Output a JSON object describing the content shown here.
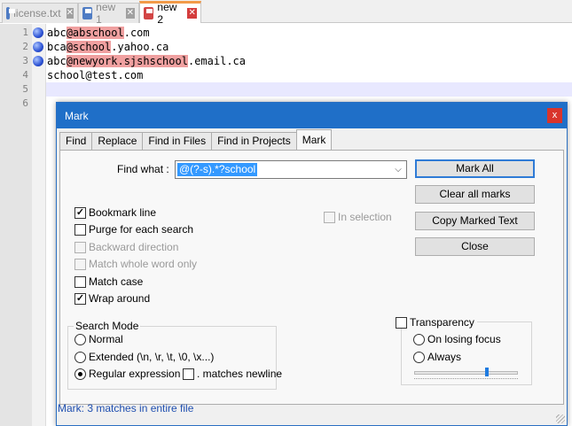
{
  "tabs": [
    {
      "label": "license.txt",
      "icon": "save-file-icon",
      "active": false
    },
    {
      "label": "new 1",
      "icon": "save-file-icon",
      "active": false
    },
    {
      "label": "new 2",
      "icon": "unsaved-file-icon",
      "active": true
    }
  ],
  "editor": {
    "lines": [
      {
        "num": "1",
        "bookmark": true,
        "pre": "abc",
        "hl": "@abschool",
        "post": ".com"
      },
      {
        "num": "2",
        "bookmark": true,
        "pre": "bca",
        "hl": "@school",
        "post": ".yahoo.ca"
      },
      {
        "num": "3",
        "bookmark": true,
        "pre": "abc",
        "hl": "@newyork.sjshschool",
        "post": ".email.ca"
      },
      {
        "num": "4",
        "bookmark": false,
        "pre": "school@test.com",
        "hl": "",
        "post": ""
      },
      {
        "num": "5",
        "bookmark": false,
        "pre": "",
        "hl": "",
        "post": ""
      },
      {
        "num": "6",
        "bookmark": false,
        "pre": "",
        "hl": "",
        "post": ""
      }
    ],
    "highlight_color": "#f0a0a0"
  },
  "dialog": {
    "title": "Mark",
    "close_glyph": "x",
    "tabs": [
      "Find",
      "Replace",
      "Find in Files",
      "Find in Projects",
      "Mark"
    ],
    "find_what_label": "Find what :",
    "find_what_value": "@(?-s).*?school",
    "in_selection": "In selection",
    "buttons": {
      "mark_all": "Mark All",
      "clear_all": "Clear all marks",
      "copy_marked": "Copy Marked Text",
      "close": "Close"
    },
    "options": {
      "bookmark_line": "Bookmark line",
      "purge": "Purge for each search",
      "backward": "Backward direction",
      "whole_word": "Match whole word only",
      "match_case": "Match case",
      "wrap_around": "Wrap around"
    },
    "search_mode": {
      "title": "Search Mode",
      "normal": "Normal",
      "extended": "Extended (\\n, \\r, \\t, \\0, \\x...)",
      "regex": "Regular expression",
      "matches_newline": ". matches newline"
    },
    "transparency": {
      "title": "Transparency",
      "on_losing_focus": "On losing focus",
      "always": "Always",
      "level": 0.7
    },
    "status": "Mark: 3 matches in entire file",
    "accent_color": "#1f6fc8"
  }
}
